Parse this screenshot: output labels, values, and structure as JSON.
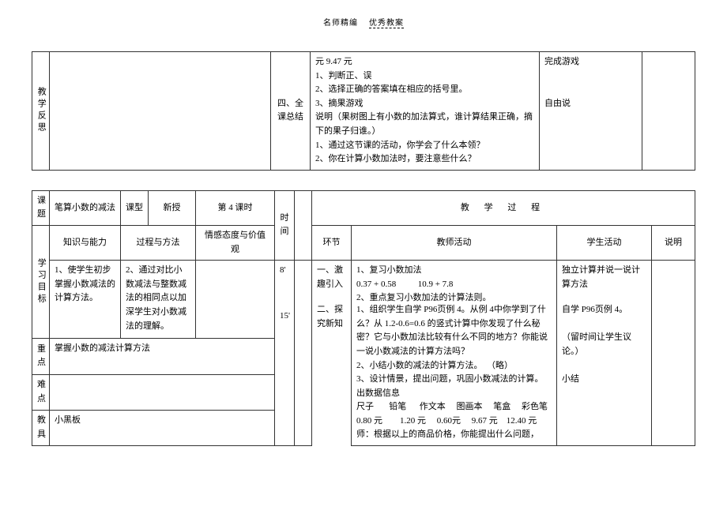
{
  "header": {
    "left": "名师精编",
    "right": "优秀教案"
  },
  "table1": {
    "rowLabel": "教学反思",
    "col3Label": "四、全课总结",
    "col4Lines": [
      "元                    9.47 元",
      "1、判断正、误",
      "2、选择正确的答案填在相应的括号里。",
      "3、摘果游戏",
      "说明（果树图上有小数的加法算式，谁计算结果正确，摘下的果子归谁。）",
      "",
      "1、通过这节课的活动，你学会了什么本领？",
      "2、你在计算小数加法时，要注意些什么？"
    ],
    "col5Lines": [
      "完成游戏",
      "",
      "",
      "自由说"
    ]
  },
  "table2": {
    "row1": {
      "keti": "课题",
      "ketiVal": "笔算小数的减法",
      "kexing": "课型",
      "kexingVal": "新授",
      "keshi": "第 4 课时",
      "shijian": "时间",
      "process": "教   学   过   程"
    },
    "row2": {
      "col1": "知识与能力",
      "col2": "过程与方法",
      "col3": "情感态度与价值观",
      "time1": "8'",
      "huanjie": "环节",
      "teacher": "教师活动",
      "student": "学生活动",
      "shuoming": "说明"
    },
    "row3": {
      "label": "学习目标",
      "col1": "1、使学生初步掌握小数减法的计算方法。",
      "col2": "2、通过对比小数减法与整数减法的相同点以加深学生对小数减法的理解。",
      "col3": "",
      "time2": "15'",
      "seg1": "一、激趣引入",
      "seg1Teacher": "1、复习小数加法\n0.37 + 0.58          10.9 + 7.8\n2、重点复习小数加法的计算法则。",
      "seg1Student": "独立计算并说一说计算方法",
      "seg2": "二、探究新知",
      "seg2Teacher": "1、组织学生自学 P96页例 4。从例 4中你学到了什么？从 1.2-0.6=0.6 的竖式计算中你发现了什么秘密？它与小数加法比较有什么不同的地方？你能说一说小数减法的计算方法吗？\n2、小结小数的减法的计算方法。  （略）\n3、设计情景，提出问题，巩固小数减法的计算。出数据信息\n尺子       铅笔      作文本     图画本     笔盒     彩色笔\n0.80 元        1.20 元     0.60元     9.67 元    12.40 元\n师：根据以上的商品价格，你能提出什么问题，",
      "seg2Student": "自学 P96页例 4。\n\n（留时间让学生议论。）\n\n小结"
    },
    "row4": {
      "label": "重点",
      "val": "掌握小数的减法计算方法"
    },
    "row5": {
      "label": "难点",
      "val": ""
    },
    "row6": {
      "label": "教具",
      "val": "小黑板"
    }
  }
}
